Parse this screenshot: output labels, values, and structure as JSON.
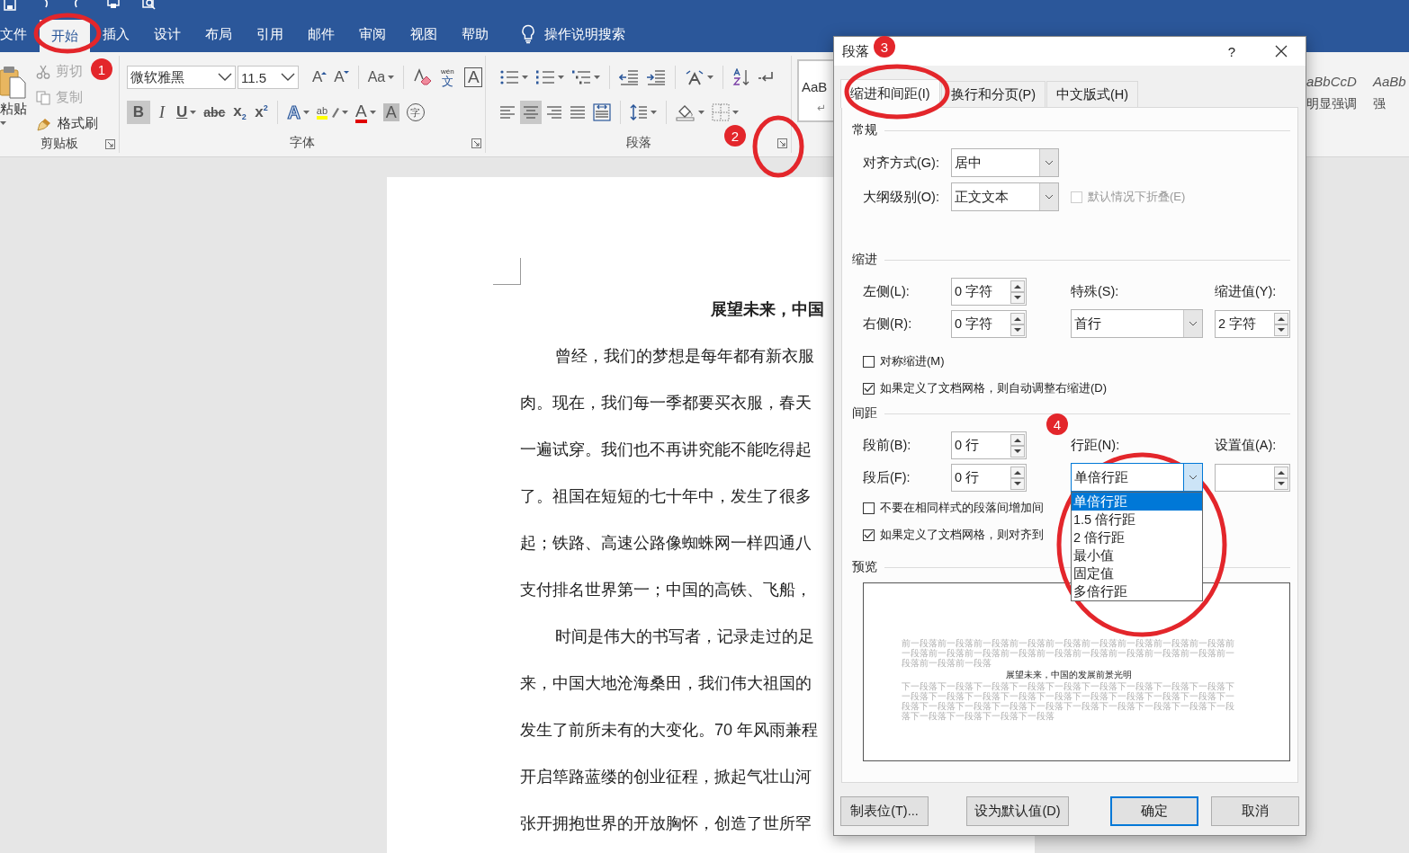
{
  "ribbon_tabs": [
    {
      "label": "文件",
      "selected": false
    },
    {
      "label": "开始",
      "selected": true
    },
    {
      "label": "插入",
      "selected": false
    },
    {
      "label": "设计",
      "selected": false
    },
    {
      "label": "布局",
      "selected": false
    },
    {
      "label": "引用",
      "selected": false
    },
    {
      "label": "邮件",
      "selected": false
    },
    {
      "label": "审阅",
      "selected": false
    },
    {
      "label": "视图",
      "selected": false
    },
    {
      "label": "帮助",
      "selected": false
    }
  ],
  "tell_me": {
    "label": "操作说明搜索"
  },
  "clipboard": {
    "group_label": "剪贴板",
    "paste": "粘贴",
    "commands": [
      {
        "kind": "cut",
        "label": "剪切",
        "disabled": true
      },
      {
        "kind": "copy",
        "label": "复制",
        "disabled": true
      },
      {
        "kind": "painter",
        "label": "格式刷",
        "disabled": false
      }
    ]
  },
  "font": {
    "group_label": "字体",
    "name": "微软雅黑",
    "size": "11.5",
    "row1": [
      {
        "kind": "grow",
        "glyph": "A"
      },
      {
        "kind": "shrink",
        "glyph": "A"
      },
      {
        "kind": "case",
        "glyph": "Aa",
        "dropdown": true
      },
      {
        "kind": "clear"
      },
      {
        "kind": "phonetic",
        "glyph": "文",
        "ruby": "wén"
      },
      {
        "kind": "boxed",
        "glyph": "A"
      }
    ],
    "row2": [
      {
        "kind": "bold",
        "glyph": "B",
        "pressed": true
      },
      {
        "kind": "italic",
        "glyph": "I",
        "pressed": false
      },
      {
        "kind": "underline",
        "glyph": "U",
        "pressed": false,
        "dropdown": true
      },
      {
        "kind": "strike",
        "glyph": "abc",
        "pressed": false
      },
      {
        "kind": "sub",
        "glyph": "x$_{2}$",
        "pressed": false
      },
      {
        "kind": "sup",
        "glyph": "x$^{2}$",
        "pressed": false
      },
      {
        "kind": "effects",
        "glyph": "A",
        "pressed": false,
        "dropdown": true
      },
      {
        "kind": "highlight",
        "glyph": "ab",
        "pressed": false,
        "dropdown": true
      },
      {
        "kind": "color",
        "glyph": "A",
        "pressed": false,
        "dropdown": true
      },
      {
        "kind": "shade",
        "glyph": "A",
        "pressed": false
      },
      {
        "kind": "enclose",
        "glyph": "字",
        "pressed": false
      }
    ]
  },
  "paragraph": {
    "group_label": "段落",
    "row1": [
      {
        "kind": "bullets",
        "dropdown": true
      },
      {
        "kind": "numbering",
        "dropdown": true
      },
      {
        "kind": "multilevel",
        "dropdown": true
      },
      {
        "kind": "outdent"
      },
      {
        "kind": "indent"
      },
      {
        "kind": "asian",
        "dropdown": true
      },
      {
        "kind": "sort"
      },
      {
        "kind": "marks"
      }
    ],
    "row2": [
      {
        "kind": "align-left",
        "pressed": false
      },
      {
        "kind": "align-center",
        "pressed": true
      },
      {
        "kind": "align-right",
        "pressed": false
      },
      {
        "kind": "justify",
        "pressed": false
      },
      {
        "kind": "distributed",
        "pressed": false
      },
      {
        "kind": "line-spacing",
        "pressed": false,
        "dropdown": true
      },
      {
        "kind": "shading",
        "pressed": false,
        "dropdown": true
      },
      {
        "kind": "borders",
        "pressed": false,
        "dropdown": true
      }
    ]
  },
  "styles": [
    {
      "kind": "normal",
      "sample": "AaB",
      "name": "↵",
      "selected": true
    },
    {
      "kind": "italic",
      "sample": "aBbCcD",
      "name": "明显强调",
      "selected": false
    },
    {
      "kind": "italic",
      "sample": "AaBb",
      "name": "强",
      "selected": false
    }
  ],
  "document": {
    "lines": [
      {
        "kind": "title",
        "text": "展望未来，中国"
      },
      {
        "kind": "first",
        "text": "曾经，我们的梦想是每年都有新衣服"
      },
      {
        "kind": "cont",
        "text": "肉。现在，我们每一季都要买衣服，春天"
      },
      {
        "kind": "cont",
        "text": "一遍试穿。我们也不再讲究能不能吃得起"
      },
      {
        "kind": "cont",
        "text": "了。祖国在短短的七十年中，发生了很多"
      },
      {
        "kind": "cont",
        "text": "起；铁路、高速公路像蜘蛛网一样四通八"
      },
      {
        "kind": "cont",
        "text": "支付排名世界第一；中国的高铁、飞船，"
      },
      {
        "kind": "first",
        "text": "时间是伟大的书写者，记录走过的足"
      },
      {
        "kind": "cont",
        "text": "来，中国大地沧海桑田，我们伟大祖国的"
      },
      {
        "kind": "cont",
        "text": "发生了前所未有的大变化。70 年风雨兼程"
      },
      {
        "kind": "cont",
        "text": "开启筚路蓝缕的创业征程，掀起气壮山河"
      },
      {
        "kind": "cont",
        "text": "张开拥抱世界的开放胸怀，创造了世所罕"
      }
    ]
  },
  "dialog": {
    "title": "段落",
    "help": "?",
    "tabs": [
      {
        "label": "缩进和间距(I)",
        "selected": true
      },
      {
        "label": "换行和分页(P)",
        "selected": false
      },
      {
        "label": "中文版式(H)",
        "selected": false
      }
    ],
    "sections": [
      {
        "heading": "常规",
        "rows": [
          {
            "kind": "fields",
            "cells": [
              {
                "kind": "label",
                "text": "对齐方式(G):"
              },
              {
                "kind": "combo",
                "value": "居中",
                "expanded": false
              }
            ]
          },
          {
            "kind": "fields",
            "cells": [
              {
                "kind": "label",
                "text": "大纲级别(O):"
              },
              {
                "kind": "combo",
                "value": "正文文本",
                "expanded": false
              },
              {
                "kind": "checkbox",
                "label": "默认情况下折叠(E)",
                "checked": false,
                "disabled": true
              }
            ]
          }
        ]
      },
      {
        "heading": "缩进",
        "rows": [
          {
            "kind": "fields",
            "cells": [
              {
                "kind": "label",
                "text": "左侧(L):"
              },
              {
                "kind": "spin",
                "value": "0 字符"
              },
              {
                "kind": "label",
                "text": "特殊(S):"
              },
              {
                "kind": "label",
                "text": "缩进值(Y):"
              }
            ]
          },
          {
            "kind": "fields",
            "cells": [
              {
                "kind": "label",
                "text": "右侧(R):"
              },
              {
                "kind": "spin",
                "value": "0 字符"
              },
              {
                "kind": "combo",
                "value": "首行",
                "expanded": false
              },
              {
                "kind": "spin",
                "value": "2 字符"
              }
            ]
          },
          {
            "kind": "checkbox",
            "label": "对称缩进(M)",
            "checked": false,
            "disabled": false
          },
          {
            "kind": "checkbox",
            "label": "如果定义了文档网格，则自动调整右缩进(D)",
            "checked": true,
            "disabled": false
          }
        ]
      },
      {
        "heading": "间距",
        "rows": [
          {
            "kind": "fields",
            "cells": [
              {
                "kind": "label",
                "text": "段前(B):"
              },
              {
                "kind": "spin",
                "value": "0 行"
              },
              {
                "kind": "label",
                "text": "行距(N):"
              },
              {
                "kind": "label",
                "text": "设置值(A):"
              }
            ]
          },
          {
            "kind": "fields",
            "cells": [
              {
                "kind": "label",
                "text": "段后(F):"
              },
              {
                "kind": "spin",
                "value": "0 行"
              },
              {
                "kind": "combo",
                "value": "单倍行距",
                "expanded": true,
                "options": [
                  {
                    "text": "单倍行距",
                    "selected": true
                  },
                  {
                    "text": "1.5 倍行距",
                    "selected": false
                  },
                  {
                    "text": "2 倍行距",
                    "selected": false
                  },
                  {
                    "text": "最小值",
                    "selected": false
                  },
                  {
                    "text": "固定值",
                    "selected": false
                  },
                  {
                    "text": "多倍行距",
                    "selected": false
                  }
                ]
              },
              {
                "kind": "spin"
              }
            ]
          },
          {
            "kind": "checkbox",
            "label": "不要在相同样式的段落间增加间",
            "checked": false,
            "disabled": false
          },
          {
            "kind": "checkbox",
            "label": "如果定义了文档网格，则对齐到",
            "checked": true,
            "disabled": false
          }
        ]
      },
      {
        "heading": "预览",
        "preview": {
          "before": "前一段落前一段落前一段落前一段落前一段落前一段落前一段落前一段落前一段落前一段落前一段落前一段落前一段落前一段落前一段落前一段落前一段落前一段落前一段落前一段落前一段落",
          "sample": "展望未来，中国的发展前景光明",
          "after": "下一段落下一段落下一段落下一段落下一段落下一段落下一段落下一段落下一段落下一段落下一段落下一段落下一段落下一段落下一段落下一段落下一段落下一段落下一段落下一段落下一段落下一段落下一段落下一段落下一段落下一段落下一段落下一段落下一段落下一段落下一段落下一段落"
        }
      }
    ],
    "buttons": [
      {
        "label": "制表位(T)...",
        "default": false
      },
      {
        "label": "设为默认值(D)",
        "default": false
      },
      {
        "label": "确定",
        "default": true
      },
      {
        "label": "取消",
        "default": false
      }
    ]
  },
  "annotations": [
    {
      "number": "1"
    },
    {
      "number": "2"
    },
    {
      "number": "3"
    },
    {
      "number": "4"
    }
  ]
}
